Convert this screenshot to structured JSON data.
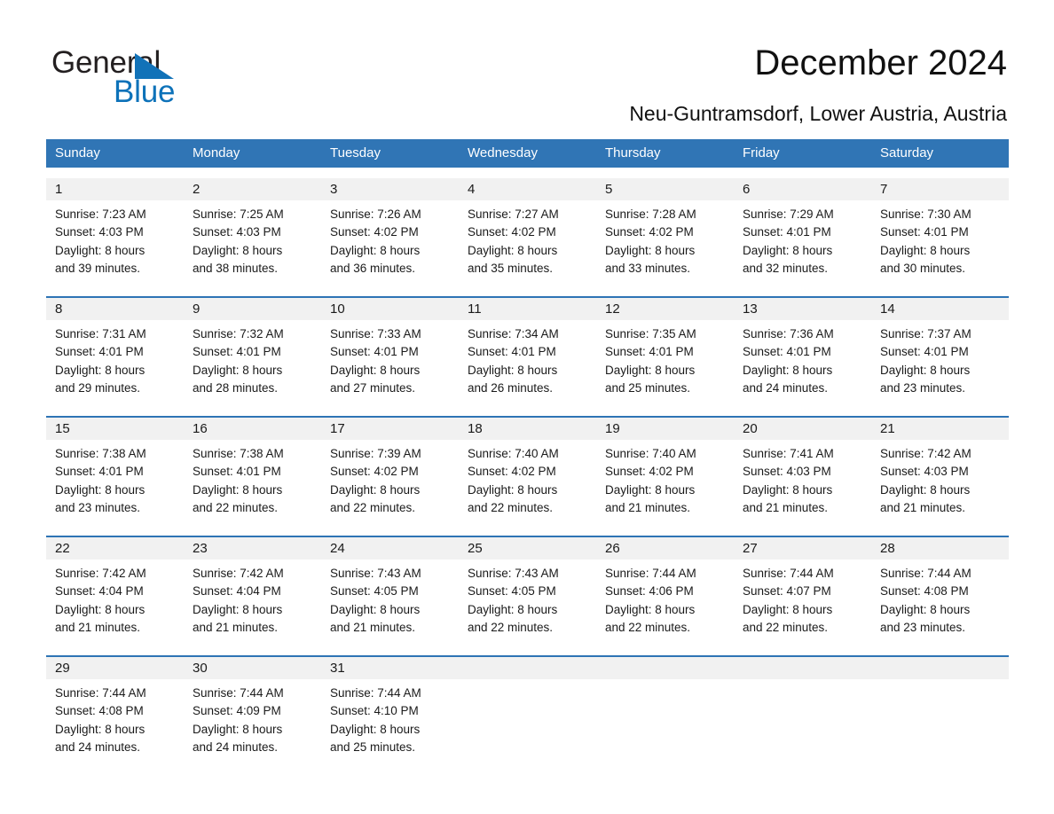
{
  "brand": {
    "name_part1": "General",
    "name_part2": "Blue",
    "triangle_color": "#1172b8",
    "blue_color": "#0d72b9"
  },
  "header": {
    "title": "December 2024",
    "location": "Neu-Guntramsdorf, Lower Austria, Austria",
    "header_bg": "#3075b5",
    "rule_color": "#2e74b5",
    "daynum_bg": "#f1f1f1"
  },
  "weekdays": [
    "Sunday",
    "Monday",
    "Tuesday",
    "Wednesday",
    "Thursday",
    "Friday",
    "Saturday"
  ],
  "weeks": [
    {
      "days": [
        {
          "num": "1",
          "sunrise": "Sunrise: 7:23 AM",
          "sunset": "Sunset: 4:03 PM",
          "daylight1": "Daylight: 8 hours",
          "daylight2": "and 39 minutes."
        },
        {
          "num": "2",
          "sunrise": "Sunrise: 7:25 AM",
          "sunset": "Sunset: 4:03 PM",
          "daylight1": "Daylight: 8 hours",
          "daylight2": "and 38 minutes."
        },
        {
          "num": "3",
          "sunrise": "Sunrise: 7:26 AM",
          "sunset": "Sunset: 4:02 PM",
          "daylight1": "Daylight: 8 hours",
          "daylight2": "and 36 minutes."
        },
        {
          "num": "4",
          "sunrise": "Sunrise: 7:27 AM",
          "sunset": "Sunset: 4:02 PM",
          "daylight1": "Daylight: 8 hours",
          "daylight2": "and 35 minutes."
        },
        {
          "num": "5",
          "sunrise": "Sunrise: 7:28 AM",
          "sunset": "Sunset: 4:02 PM",
          "daylight1": "Daylight: 8 hours",
          "daylight2": "and 33 minutes."
        },
        {
          "num": "6",
          "sunrise": "Sunrise: 7:29 AM",
          "sunset": "Sunset: 4:01 PM",
          "daylight1": "Daylight: 8 hours",
          "daylight2": "and 32 minutes."
        },
        {
          "num": "7",
          "sunrise": "Sunrise: 7:30 AM",
          "sunset": "Sunset: 4:01 PM",
          "daylight1": "Daylight: 8 hours",
          "daylight2": "and 30 minutes."
        }
      ]
    },
    {
      "days": [
        {
          "num": "8",
          "sunrise": "Sunrise: 7:31 AM",
          "sunset": "Sunset: 4:01 PM",
          "daylight1": "Daylight: 8 hours",
          "daylight2": "and 29 minutes."
        },
        {
          "num": "9",
          "sunrise": "Sunrise: 7:32 AM",
          "sunset": "Sunset: 4:01 PM",
          "daylight1": "Daylight: 8 hours",
          "daylight2": "and 28 minutes."
        },
        {
          "num": "10",
          "sunrise": "Sunrise: 7:33 AM",
          "sunset": "Sunset: 4:01 PM",
          "daylight1": "Daylight: 8 hours",
          "daylight2": "and 27 minutes."
        },
        {
          "num": "11",
          "sunrise": "Sunrise: 7:34 AM",
          "sunset": "Sunset: 4:01 PM",
          "daylight1": "Daylight: 8 hours",
          "daylight2": "and 26 minutes."
        },
        {
          "num": "12",
          "sunrise": "Sunrise: 7:35 AM",
          "sunset": "Sunset: 4:01 PM",
          "daylight1": "Daylight: 8 hours",
          "daylight2": "and 25 minutes."
        },
        {
          "num": "13",
          "sunrise": "Sunrise: 7:36 AM",
          "sunset": "Sunset: 4:01 PM",
          "daylight1": "Daylight: 8 hours",
          "daylight2": "and 24 minutes."
        },
        {
          "num": "14",
          "sunrise": "Sunrise: 7:37 AM",
          "sunset": "Sunset: 4:01 PM",
          "daylight1": "Daylight: 8 hours",
          "daylight2": "and 23 minutes."
        }
      ]
    },
    {
      "days": [
        {
          "num": "15",
          "sunrise": "Sunrise: 7:38 AM",
          "sunset": "Sunset: 4:01 PM",
          "daylight1": "Daylight: 8 hours",
          "daylight2": "and 23 minutes."
        },
        {
          "num": "16",
          "sunrise": "Sunrise: 7:38 AM",
          "sunset": "Sunset: 4:01 PM",
          "daylight1": "Daylight: 8 hours",
          "daylight2": "and 22 minutes."
        },
        {
          "num": "17",
          "sunrise": "Sunrise: 7:39 AM",
          "sunset": "Sunset: 4:02 PM",
          "daylight1": "Daylight: 8 hours",
          "daylight2": "and 22 minutes."
        },
        {
          "num": "18",
          "sunrise": "Sunrise: 7:40 AM",
          "sunset": "Sunset: 4:02 PM",
          "daylight1": "Daylight: 8 hours",
          "daylight2": "and 22 minutes."
        },
        {
          "num": "19",
          "sunrise": "Sunrise: 7:40 AM",
          "sunset": "Sunset: 4:02 PM",
          "daylight1": "Daylight: 8 hours",
          "daylight2": "and 21 minutes."
        },
        {
          "num": "20",
          "sunrise": "Sunrise: 7:41 AM",
          "sunset": "Sunset: 4:03 PM",
          "daylight1": "Daylight: 8 hours",
          "daylight2": "and 21 minutes."
        },
        {
          "num": "21",
          "sunrise": "Sunrise: 7:42 AM",
          "sunset": "Sunset: 4:03 PM",
          "daylight1": "Daylight: 8 hours",
          "daylight2": "and 21 minutes."
        }
      ]
    },
    {
      "days": [
        {
          "num": "22",
          "sunrise": "Sunrise: 7:42 AM",
          "sunset": "Sunset: 4:04 PM",
          "daylight1": "Daylight: 8 hours",
          "daylight2": "and 21 minutes."
        },
        {
          "num": "23",
          "sunrise": "Sunrise: 7:42 AM",
          "sunset": "Sunset: 4:04 PM",
          "daylight1": "Daylight: 8 hours",
          "daylight2": "and 21 minutes."
        },
        {
          "num": "24",
          "sunrise": "Sunrise: 7:43 AM",
          "sunset": "Sunset: 4:05 PM",
          "daylight1": "Daylight: 8 hours",
          "daylight2": "and 21 minutes."
        },
        {
          "num": "25",
          "sunrise": "Sunrise: 7:43 AM",
          "sunset": "Sunset: 4:05 PM",
          "daylight1": "Daylight: 8 hours",
          "daylight2": "and 22 minutes."
        },
        {
          "num": "26",
          "sunrise": "Sunrise: 7:44 AM",
          "sunset": "Sunset: 4:06 PM",
          "daylight1": "Daylight: 8 hours",
          "daylight2": "and 22 minutes."
        },
        {
          "num": "27",
          "sunrise": "Sunrise: 7:44 AM",
          "sunset": "Sunset: 4:07 PM",
          "daylight1": "Daylight: 8 hours",
          "daylight2": "and 22 minutes."
        },
        {
          "num": "28",
          "sunrise": "Sunrise: 7:44 AM",
          "sunset": "Sunset: 4:08 PM",
          "daylight1": "Daylight: 8 hours",
          "daylight2": "and 23 minutes."
        }
      ]
    },
    {
      "days": [
        {
          "num": "29",
          "sunrise": "Sunrise: 7:44 AM",
          "sunset": "Sunset: 4:08 PM",
          "daylight1": "Daylight: 8 hours",
          "daylight2": "and 24 minutes."
        },
        {
          "num": "30",
          "sunrise": "Sunrise: 7:44 AM",
          "sunset": "Sunset: 4:09 PM",
          "daylight1": "Daylight: 8 hours",
          "daylight2": "and 24 minutes."
        },
        {
          "num": "31",
          "sunrise": "Sunrise: 7:44 AM",
          "sunset": "Sunset: 4:10 PM",
          "daylight1": "Daylight: 8 hours",
          "daylight2": "and 25 minutes."
        },
        {
          "num": "",
          "sunrise": "",
          "sunset": "",
          "daylight1": "",
          "daylight2": ""
        },
        {
          "num": "",
          "sunrise": "",
          "sunset": "",
          "daylight1": "",
          "daylight2": ""
        },
        {
          "num": "",
          "sunrise": "",
          "sunset": "",
          "daylight1": "",
          "daylight2": ""
        },
        {
          "num": "",
          "sunrise": "",
          "sunset": "",
          "daylight1": "",
          "daylight2": ""
        }
      ]
    }
  ]
}
